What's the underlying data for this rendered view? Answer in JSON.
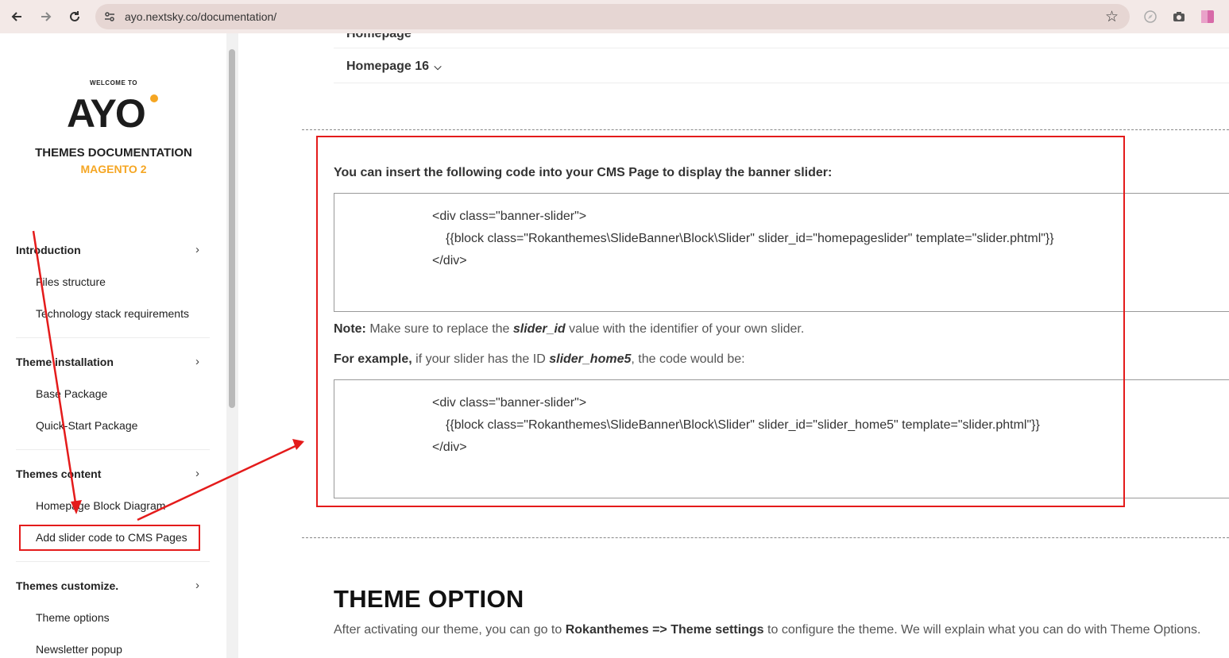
{
  "browser": {
    "url": "ayo.nextsky.co/documentation/"
  },
  "sidebar": {
    "welcome": "WELCOME TO",
    "logo": "AYO",
    "title": "THEMES DOCUMENTATION",
    "subtitle": "MAGENTO 2",
    "sections": [
      {
        "label": "Introduction",
        "items": [
          "Files structure",
          "Technology stack requirements"
        ]
      },
      {
        "label": "Theme installation",
        "items": [
          "Base Package",
          "Quick-Start Package"
        ]
      },
      {
        "label": "Themes content",
        "items": [
          "Homepage Block Diagram",
          "Add slider code to CMS Pages"
        ]
      },
      {
        "label": "Themes customize.",
        "items": [
          "Theme options",
          "Newsletter popup"
        ]
      }
    ]
  },
  "main": {
    "tab_partial": "Homepage",
    "tab_label": "Homepage 16",
    "intro": "You can insert the following code into your CMS Page to display the banner slider:",
    "code1": [
      "<div class=\"banner-slider\">",
      "{{block class=\"Rokanthemes\\SlideBanner\\Block\\Slider\" slider_id=\"homepageslider\" template=\"slider.phtml\"}}",
      "</div>"
    ],
    "note_label": "Note:",
    "note_pre": " Make sure to replace the ",
    "note_em": "slider_id",
    "note_post": " value with the identifier of your own slider.",
    "example_label": "For example,",
    "example_pre": " if your slider has the ID ",
    "example_em": "slider_home5",
    "example_post": ", the code would be:",
    "code2": [
      "<div class=\"banner-slider\">",
      "{{block class=\"Rokanthemes\\SlideBanner\\Block\\Slider\" slider_id=\"slider_home5\" template=\"slider.phtml\"}}",
      "</div>"
    ],
    "heading": "THEME OPTION",
    "bottom_pre": "After activating our theme, you can go to ",
    "bottom_bold": "Rokanthemes => Theme settings",
    "bottom_post": " to configure the theme. We will explain what you can do with Theme Options."
  },
  "colors": {
    "annotation_red": "#e41b1b",
    "brand_orange": "#f5a623"
  }
}
